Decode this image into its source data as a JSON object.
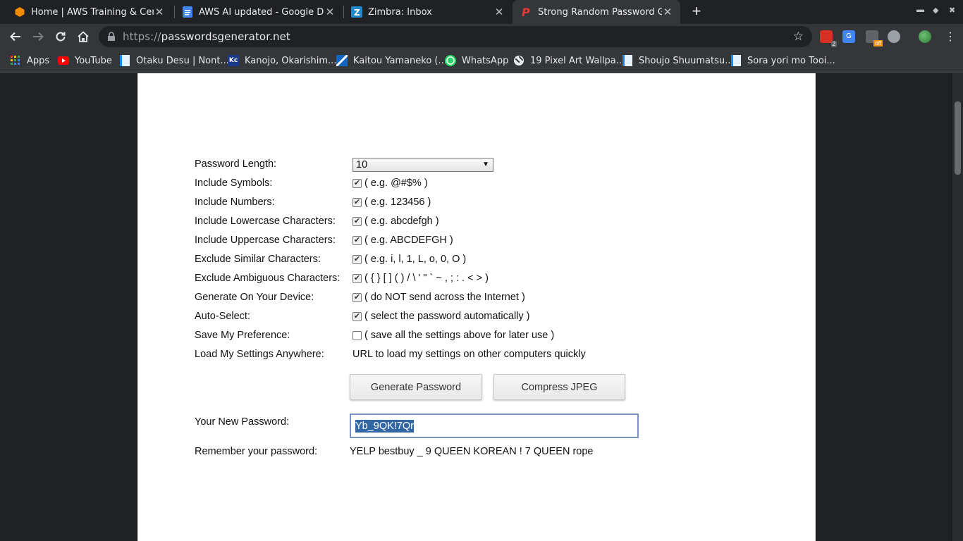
{
  "browser": {
    "tabs": [
      {
        "title": "Home | AWS Training & Certific",
        "active": false,
        "icon": "aws-hexagon-icon"
      },
      {
        "title": "AWS AI updated - Google Docs",
        "active": false,
        "icon": "google-docs-icon"
      },
      {
        "title": "Zimbra: Inbox",
        "active": false,
        "icon": "zimbra-icon"
      },
      {
        "title": "Strong Random Password Gene",
        "active": true,
        "icon": "p-logo-icon"
      }
    ],
    "url_scheme": "https://",
    "url_host": "passwordsgenerator.net",
    "extension_badge": "2",
    "extension_off_label": "off",
    "bookmarks": [
      {
        "label": "Apps",
        "icon": "apps-grid-icon"
      },
      {
        "label": "YouTube",
        "icon": "youtube-icon"
      },
      {
        "label": "Otaku Desu | Nont...",
        "icon": "page-icon"
      },
      {
        "label": "Kanojo, Okarishim...",
        "icon": "kc-icon"
      },
      {
        "label": "Kaitou Yamaneko (...",
        "icon": "stripe-icon"
      },
      {
        "label": "WhatsApp",
        "icon": "whatsapp-icon"
      },
      {
        "label": "19 Pixel Art Wallpa...",
        "icon": "globe-icon"
      },
      {
        "label": "Shoujo Shuumatsu...",
        "icon": "page-icon"
      },
      {
        "label": "Sora yori mo Tooi...",
        "icon": "page-icon"
      }
    ]
  },
  "form": {
    "length_label": "Password Length:",
    "length_value": "10",
    "options": [
      {
        "label": "Include Symbols:",
        "checked": true,
        "desc": "( e.g. @#$% )"
      },
      {
        "label": "Include Numbers:",
        "checked": true,
        "desc": "( e.g. 123456 )"
      },
      {
        "label": "Include Lowercase Characters:",
        "checked": true,
        "desc": "( e.g. abcdefgh )"
      },
      {
        "label": "Include Uppercase Characters:",
        "checked": true,
        "desc": "( e.g. ABCDEFGH )"
      },
      {
        "label": "Exclude Similar Characters:",
        "checked": true,
        "desc": "( e.g. i, l, 1, L, o, 0, O )"
      },
      {
        "label": "Exclude Ambiguous Characters:",
        "checked": true,
        "desc": "( { } [ ] ( ) / \\ ' \" ` ~ , ; : . < > )"
      },
      {
        "label": "Generate On Your Device:",
        "checked": true,
        "desc": "( do NOT send across the Internet )"
      },
      {
        "label": "Auto-Select:",
        "checked": true,
        "desc": "( select the password automatically )"
      },
      {
        "label": "Save My Preference:",
        "checked": false,
        "desc": "( save all the settings above for later use )"
      }
    ],
    "load_settings_label": "Load My Settings Anywhere:",
    "load_settings_value": "URL to load my settings on other computers quickly",
    "generate_button": "Generate Password",
    "compress_button": "Compress JPEG",
    "new_password_label": "Your New Password:",
    "new_password_value": "Yb_9QK!7Qr",
    "remember_label": "Remember your password:",
    "remember_value": "YELP bestbuy _ 9 QUEEN KOREAN ! 7 QUEEN rope"
  },
  "colors": {
    "chrome_dark": "#202124",
    "toolbar": "#35363a",
    "selection": "#3367a4"
  }
}
